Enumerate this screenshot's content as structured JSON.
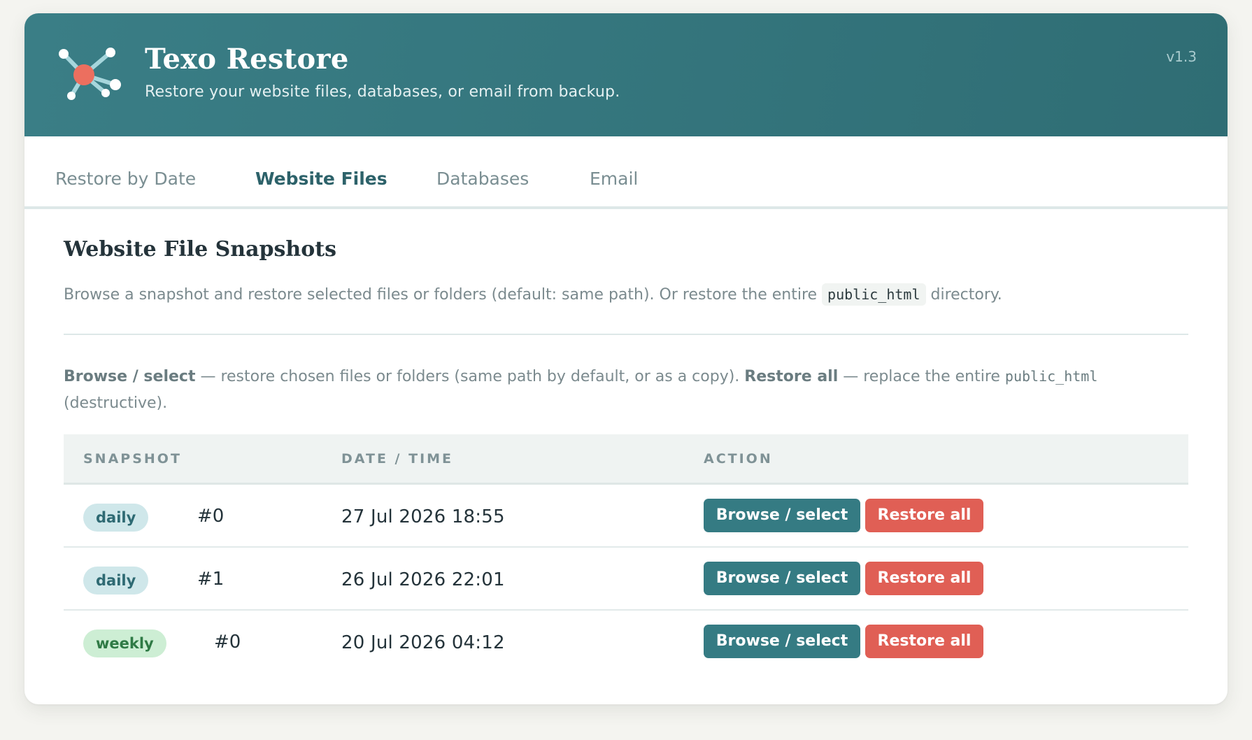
{
  "app": {
    "title": "Texo Restore",
    "subtitle": "Restore your website files, databases, or email from backup.",
    "version": "v1.3"
  },
  "tabs": [
    {
      "label": "Restore by Date",
      "active": false
    },
    {
      "label": "Website Files",
      "active": true
    },
    {
      "label": "Databases",
      "active": false
    },
    {
      "label": "Email",
      "active": false
    }
  ],
  "section": {
    "title": "Website File Snapshots",
    "desc_before": "Browse a snapshot and restore selected files or folders (default: same path). Or restore the entire ",
    "desc_code": "public_html",
    "desc_after": " directory."
  },
  "hint": {
    "browse_label": "Browse / select",
    "browse_text": " — restore chosen files or folders (same path by default, or as a copy). ",
    "restore_label": "Restore all",
    "restore_text": " — replace the entire ",
    "restore_code": "public_html",
    "restore_tail": " (destructive)."
  },
  "table": {
    "headers": [
      "SNAPSHOT",
      "DATE / TIME",
      "ACTION"
    ],
    "rows": [
      {
        "type": "daily",
        "num": "#0",
        "datetime": "27 Jul 2026 18:55"
      },
      {
        "type": "daily",
        "num": "#1",
        "datetime": "26 Jul 2026 22:01"
      },
      {
        "type": "weekly",
        "num": "#0",
        "datetime": "20 Jul 2026 04:12"
      }
    ],
    "browse_label": "Browse / select",
    "restore_label": "Restore all"
  },
  "colors": {
    "header": "#357b83",
    "accent": "#357b83",
    "danger": "#e05f55",
    "logo_node": "#ec6f5f",
    "daily_pill": "#cfe7ea",
    "weekly_pill": "#cdeed4"
  },
  "icons": {
    "logo": "network-hub-icon"
  }
}
